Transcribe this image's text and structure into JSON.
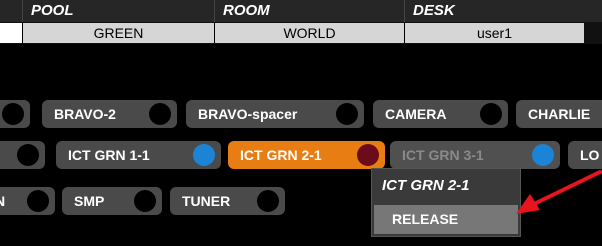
{
  "header": {
    "columns": [
      "POOL",
      "ROOM",
      "DESK"
    ],
    "values": [
      "GREEN",
      "WORLD",
      "user1"
    ]
  },
  "chips": {
    "row1": [
      "BRAVO-2",
      "BRAVO-spacer",
      "CAMERA",
      "CHARLIE"
    ],
    "row2": [
      "ICT GRN 1-1",
      "ICT GRN 2-1",
      "ICT GRN 3-1",
      "LO"
    ],
    "row3": [
      "N",
      "SMP",
      "TUNER"
    ]
  },
  "context_menu": {
    "title": "ICT GRN 2-1",
    "items": [
      "RELEASE"
    ]
  },
  "colors": {
    "accent": "#e87d14",
    "active_indicator": "#1c84d6",
    "selected_indicator": "#6c0c1a",
    "annotation_arrow": "#e8141e"
  }
}
